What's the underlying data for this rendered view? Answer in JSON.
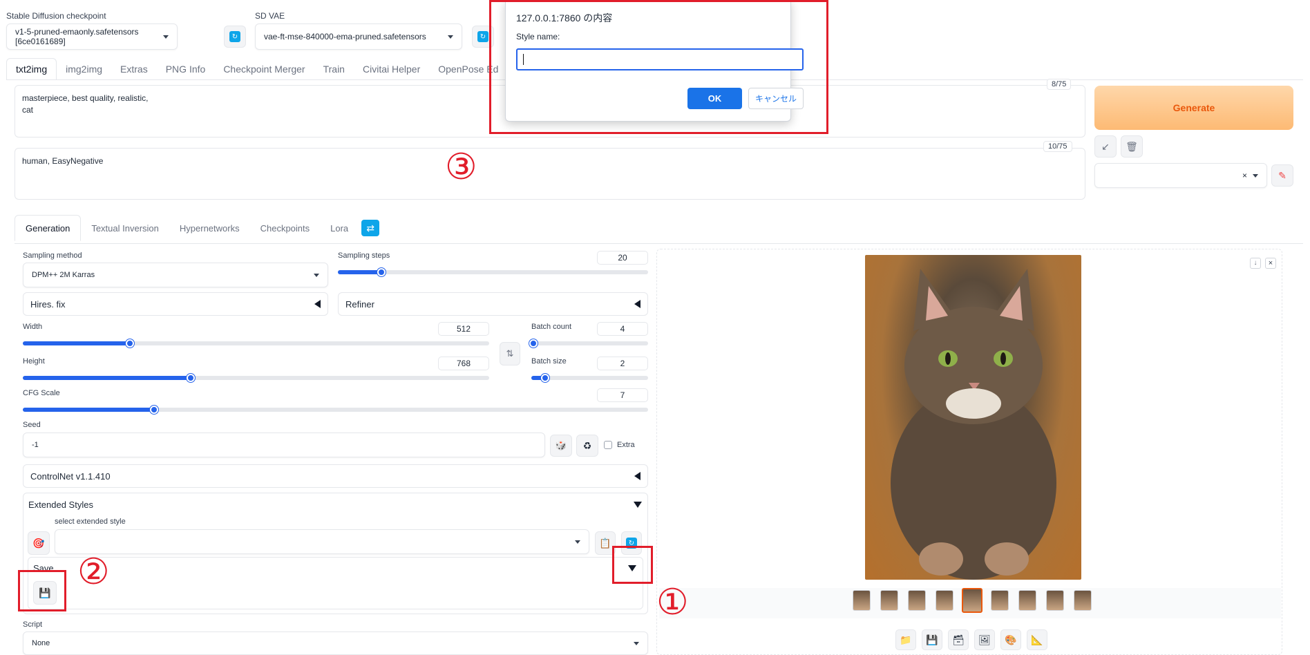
{
  "top": {
    "ckpt_label": "Stable Diffusion checkpoint",
    "ckpt_value": "v1-5-pruned-emaonly.safetensors [6ce0161689]",
    "vae_label": "SD VAE",
    "vae_value": "vae-ft-mse-840000-ema-pruned.safetensors"
  },
  "tabs": [
    "txt2img",
    "img2img",
    "Extras",
    "PNG Info",
    "Checkpoint Merger",
    "Train",
    "Civitai Helper",
    "OpenPose Ed"
  ],
  "prompt": {
    "positive": "masterpiece, best quality, realistic,\ncat",
    "positive_count": "8/75",
    "negative": "human,  EasyNegative",
    "negative_count": "10/75"
  },
  "generate_label": "Generate",
  "subtabs": [
    "Generation",
    "Textual Inversion",
    "Hypernetworks",
    "Checkpoints",
    "Lora"
  ],
  "params": {
    "sampling_method_label": "Sampling method",
    "sampling_method": "DPM++ 2M Karras",
    "steps_label": "Sampling steps",
    "steps": "20",
    "steps_frac": 0.14,
    "hires": "Hires. fix",
    "refiner": "Refiner",
    "width_label": "Width",
    "width": "512",
    "width_frac": 0.23,
    "height_label": "Height",
    "height": "768",
    "height_frac": 0.36,
    "batch_count_label": "Batch count",
    "batch_count": "4",
    "batch_count_frac": 0.02,
    "batch_size_label": "Batch size",
    "batch_size": "2",
    "batch_size_frac": 0.12,
    "cfg_label": "CFG Scale",
    "cfg": "7",
    "cfg_frac": 0.21,
    "seed_label": "Seed",
    "seed": "-1",
    "extra_label": "Extra"
  },
  "controlnet": "ControlNet v1.1.410",
  "ext_styles": {
    "title": "Extended Styles",
    "select_label": "select extended style",
    "save_label": "Save"
  },
  "script": {
    "label": "Script",
    "value": "None"
  },
  "dialog": {
    "title": "127.0.0.1:7860 の内容",
    "prompt": "Style name:",
    "ok": "OK",
    "cancel": "キャンセル"
  },
  "annotations": {
    "one": "①",
    "two": "②",
    "three": "③"
  },
  "colors": {
    "accent": "#2563eb",
    "generate": "#ea580c",
    "annotation": "#e11d2a"
  }
}
